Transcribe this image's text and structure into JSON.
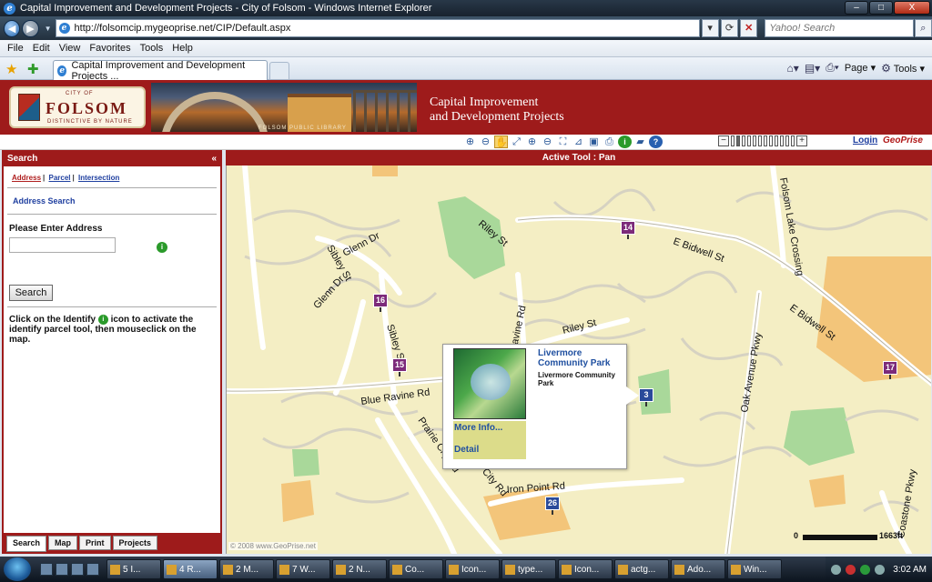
{
  "window": {
    "title": "Capital Improvement and Development Projects - City of Folsom - Windows Internet Explorer",
    "controls": [
      "–",
      "□",
      "X"
    ]
  },
  "addressbar": {
    "url": "http://folsomcip.mygeoprise.net/CIP/Default.aspx",
    "search_placeholder": "Yahoo! Search"
  },
  "menu": [
    "File",
    "Edit",
    "View",
    "Favorites",
    "Tools",
    "Help"
  ],
  "tab": {
    "title": "Capital Improvement and Development Projects ..."
  },
  "commands": {
    "page": "Page",
    "tools": "Tools"
  },
  "site": {
    "logo_city": "CITY OF",
    "logo_name": "FOLSOM",
    "logo_tagline": "DISTINCTIVE BY NATURE",
    "photo_caption": "FOLSOM PUBLIC LIBRARY",
    "title_line1": "Capital Improvement",
    "title_line2": "and Development Projects"
  },
  "toolbar": {
    "login": "Login",
    "brand": "GeoPrise",
    "zoom_levels": 12,
    "zoom_selected": 1
  },
  "search_panel": {
    "header": "Search",
    "collapse": "«",
    "links": [
      "Address",
      "Parcel",
      "Intersection"
    ],
    "active_link": "Address",
    "section_title": "Address Search",
    "input_label": "Please Enter Address",
    "address_value": "",
    "search_button": "Search",
    "instructions_pre": "Click on the Identify",
    "instructions_post": "icon to activate the identify parcel tool, then mouseclick on the map.",
    "tabs": [
      "Search",
      "Map",
      "Print",
      "Projects"
    ],
    "active_tab": "Search"
  },
  "map": {
    "header": "Active Tool : Pan",
    "roads": [
      "Riley St",
      "Glenn Dr",
      "Sibley St",
      "E Bidwell St",
      "Ravine Rd",
      "Blue Ravine Rd",
      "Prairie City Rd",
      "Iron Point Rd",
      "Oak Avenue Pkwy",
      "Coastone Pkwy",
      "Folsom Lake Crossing",
      "Glenn Dr"
    ],
    "markers": [
      {
        "num": "14"
      },
      {
        "num": "16"
      },
      {
        "num": "15"
      },
      {
        "num": "17"
      },
      {
        "num": "3"
      },
      {
        "num": "26"
      }
    ],
    "popup": {
      "title": "Livermore Community Park",
      "description": "Livermore Community Park",
      "more_info": "More Info...",
      "detail": "Detail"
    },
    "copyright": "© 2008 www.GeoPrise.net",
    "scale_start": "0",
    "scale_end": "1663ft"
  },
  "taskbar": {
    "tasks": [
      "5 I...",
      "4 R...",
      "2 M...",
      "7 W...",
      "2 N...",
      "Co...",
      "Icon...",
      "type...",
      "Icon...",
      "actg...",
      "Ado...",
      "Win..."
    ],
    "clock": "3:02 AM"
  }
}
